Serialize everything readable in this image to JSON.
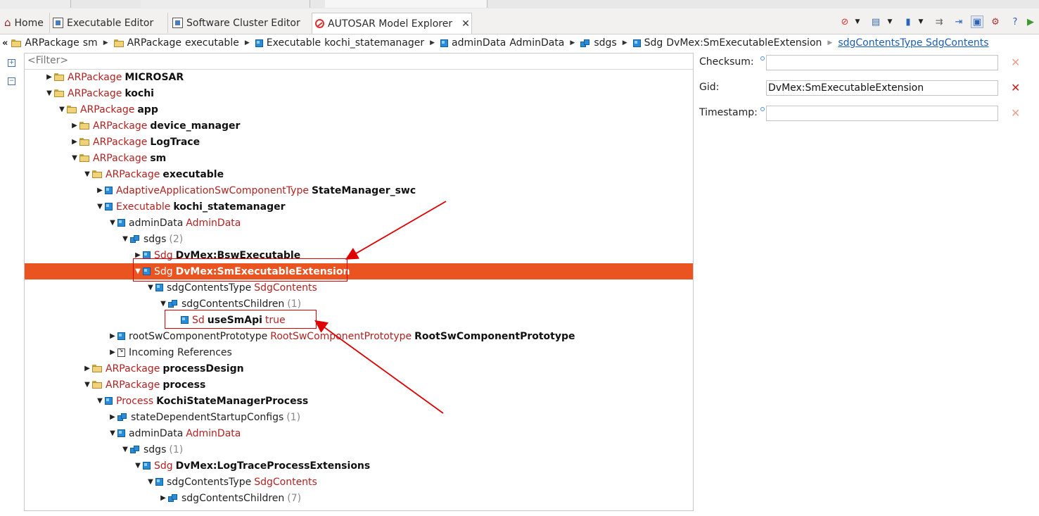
{
  "tabs": [
    {
      "label": "Home",
      "icon": "home-icon",
      "active": false
    },
    {
      "label": "Executable Editor",
      "icon": "editor-icon",
      "active": false
    },
    {
      "label": "Software Cluster Editor",
      "icon": "editor-icon",
      "active": false
    },
    {
      "label": "AUTOSAR Model Explorer",
      "icon": "autosar-icon",
      "active": true,
      "close": "✕"
    }
  ],
  "breadcrumb": {
    "items": [
      {
        "kind": "ARPackage",
        "name": "sm",
        "icon": "folder-icon"
      },
      {
        "kind": "ARPackage",
        "name": "executable",
        "icon": "folder-icon"
      },
      {
        "kind": "Executable",
        "name": "kochi_statemanager",
        "icon": "cube-icon"
      },
      {
        "kind": "adminData",
        "name": "AdminData",
        "icon": "cube-icon"
      },
      {
        "kind": "sdgs",
        "name": "",
        "icon": "cubes-icon"
      },
      {
        "kind": "Sdg",
        "name": "DvMex:SmExecutableExtension",
        "icon": "cube-icon"
      }
    ],
    "link": "sdgContentsType SdgContents"
  },
  "filter": {
    "placeholder": "<Filter>"
  },
  "tree": [
    {
      "arrow": "▶",
      "icon": "folder",
      "kw": "ARPackage",
      "name": "MICROSAR",
      "sel": false
    },
    {
      "arrow": "▼",
      "icon": "folder",
      "kw": "ARPackage",
      "name": "kochi",
      "sel": false
    },
    {
      "arrow": "▼",
      "icon": "folder",
      "kw": "ARPackage",
      "name": "app",
      "sel": false
    },
    {
      "arrow": "▶",
      "icon": "folder",
      "kw": "ARPackage",
      "name": "device_manager",
      "sel": false
    },
    {
      "arrow": "▶",
      "icon": "folder",
      "kw": "ARPackage",
      "name": "LogTrace",
      "sel": false
    },
    {
      "arrow": "▼",
      "icon": "folder",
      "kw": "ARPackage",
      "name": "sm",
      "sel": false
    },
    {
      "arrow": "▼",
      "icon": "folder",
      "kw": "ARPackage",
      "name": "executable",
      "sel": false
    },
    {
      "arrow": "▶",
      "icon": "cube",
      "kw": "AdaptiveApplicationSwComponentType",
      "name": "StateManager_swc",
      "sel": false
    },
    {
      "arrow": "▼",
      "icon": "cube",
      "kw": "Executable",
      "name": "kochi_statemanager",
      "sel": false
    },
    {
      "arrow": "▼",
      "icon": "cube",
      "plain": "adminData",
      "kw": "AdminData",
      "sel": false
    },
    {
      "arrow": "▼",
      "icon": "cubes",
      "plain": "sdgs",
      "count": "(2)",
      "sel": false
    },
    {
      "arrow": "▶",
      "icon": "cube",
      "kw": "Sdg",
      "name": "DvMex:BswExecutable",
      "sel": false
    },
    {
      "arrow": "▼",
      "icon": "cube",
      "kw": "Sdg",
      "name": "DvMex:SmExecutableExtension",
      "sel": true
    },
    {
      "arrow": "▼",
      "icon": "cube",
      "plain": "sdgContentsType",
      "kw": "SdgContents",
      "sel": false
    },
    {
      "arrow": "▼",
      "icon": "cubes",
      "plain": "sdgContentsChildren",
      "count": "(1)",
      "sel": false
    },
    {
      "arrow": "",
      "icon": "cube",
      "kw": "Sd",
      "name": "useSmApi",
      "kw2": "true",
      "sel": false
    },
    {
      "arrow": "▶",
      "icon": "cube",
      "plain": "rootSwComponentPrototype",
      "kw": "RootSwComponentPrototype",
      "name": "RootSwComponentPrototype",
      "sel": false
    },
    {
      "arrow": "▶",
      "icon": "inref",
      "plain": "Incoming References",
      "sel": false
    },
    {
      "arrow": "▶",
      "icon": "folder",
      "kw": "ARPackage",
      "name": "processDesign",
      "sel": false
    },
    {
      "arrow": "▼",
      "icon": "folder",
      "kw": "ARPackage",
      "name": "process",
      "sel": false
    },
    {
      "arrow": "▼",
      "icon": "cube",
      "kw": "Process",
      "name": "KochiStateManagerProcess",
      "sel": false
    },
    {
      "arrow": "▶",
      "icon": "cubes",
      "plain": "stateDependentStartupConfigs",
      "count": "(1)",
      "sel": false
    },
    {
      "arrow": "▼",
      "icon": "cube",
      "plain": "adminData",
      "kw": "AdminData",
      "sel": false
    },
    {
      "arrow": "▼",
      "icon": "cubes",
      "plain": "sdgs",
      "count": "(1)",
      "sel": false
    },
    {
      "arrow": "▼",
      "icon": "cube",
      "kw": "Sdg",
      "name": "DvMex:LogTraceProcessExtensions",
      "sel": false
    },
    {
      "arrow": "▼",
      "icon": "cube",
      "plain": "sdgContentsType",
      "kw": "SdgContents",
      "sel": false
    },
    {
      "arrow": "▶",
      "icon": "cubes",
      "plain": "sdgContentsChildren",
      "count": "(7)",
      "sel": false
    }
  ],
  "properties": [
    {
      "label": "Checksum:",
      "value": "",
      "clear_color": "#e8a08a"
    },
    {
      "label": "Gid:",
      "value": "DvMex:SmExecutableExtension",
      "clear_color": "#d01c1c"
    },
    {
      "label": "Timestamp:",
      "value": "",
      "clear_color": "#e8a08a"
    }
  ],
  "colors": {
    "selection": "#e95420",
    "keyword": "#b22222",
    "annotation": "#e00000"
  }
}
